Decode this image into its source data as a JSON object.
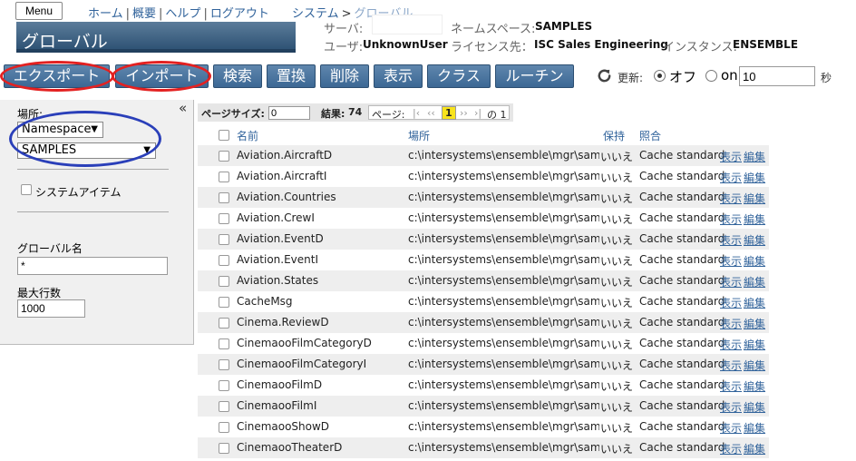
{
  "header": {
    "menu_label": "Menu",
    "nav": [
      "ホーム",
      "概要",
      "ヘルプ",
      "ログアウト"
    ],
    "nav_sep": "|",
    "breadcrumb": {
      "root": "システム",
      "sep": ">",
      "current": "グローバル"
    },
    "title": "グローバル",
    "server_label": "サーバ:",
    "server_value": "",
    "user_label": "ユーザ:",
    "user_value": "UnknownUser",
    "namespace_label": "ネームスペース:",
    "namespace_value": "SAMPLES",
    "license_label": "ライセンス先：",
    "license_value": "ISC Sales Engineering",
    "instance_label": "インスタンス:",
    "instance_value": "ENSEMBLE"
  },
  "toolbar": {
    "buttons": [
      "エクスポート",
      "インポート",
      "検索",
      "置換",
      "削除",
      "表示",
      "クラス",
      "ルーチン"
    ],
    "refresh_label": "更新:",
    "off_label": "オフ",
    "on_label": "on",
    "refresh_value": "10",
    "seconds_label": "秒",
    "refresh_mode": "off"
  },
  "sidebar": {
    "collapse_glyph": "«",
    "location_label": "場所:",
    "location_type": "Namespace",
    "location_value": "SAMPLES",
    "system_items_label": "システムアイテム",
    "global_name_label": "グローバル名",
    "global_name_value": "*",
    "max_rows_label": "最大行数",
    "max_rows_value": "1000"
  },
  "results": {
    "page_size_label": "ページサイズ:",
    "page_size_value": "0",
    "results_label": "結果:",
    "results_count": "74",
    "page_label": "ページ:",
    "nav_first": "|‹",
    "nav_prev": "‹‹",
    "current_page": "1",
    "nav_next": "››",
    "nav_last": "›|",
    "of_pages": "の 1"
  },
  "table": {
    "headers": {
      "name": "名前",
      "location": "場所",
      "keep": "保持",
      "collation": "照合"
    },
    "view_label": "表示",
    "edit_label": "編集",
    "rows": [
      {
        "name": "Aviation.AircraftD",
        "location": "c:\\intersystems\\ensemble\\mgr\\samples\\",
        "keep": "いいえ",
        "collation": "Cache standard"
      },
      {
        "name": "Aviation.AircraftI",
        "location": "c:\\intersystems\\ensemble\\mgr\\samples\\",
        "keep": "いいえ",
        "collation": "Cache standard"
      },
      {
        "name": "Aviation.Countries",
        "location": "c:\\intersystems\\ensemble\\mgr\\samples\\",
        "keep": "いいえ",
        "collation": "Cache standard"
      },
      {
        "name": "Aviation.CrewI",
        "location": "c:\\intersystems\\ensemble\\mgr\\samples\\",
        "keep": "いいえ",
        "collation": "Cache standard"
      },
      {
        "name": "Aviation.EventD",
        "location": "c:\\intersystems\\ensemble\\mgr\\samples\\",
        "keep": "いいえ",
        "collation": "Cache standard"
      },
      {
        "name": "Aviation.EventI",
        "location": "c:\\intersystems\\ensemble\\mgr\\samples\\",
        "keep": "いいえ",
        "collation": "Cache standard"
      },
      {
        "name": "Aviation.States",
        "location": "c:\\intersystems\\ensemble\\mgr\\samples\\",
        "keep": "いいえ",
        "collation": "Cache standard"
      },
      {
        "name": "CacheMsg",
        "location": "c:\\intersystems\\ensemble\\mgr\\samples\\",
        "keep": "いいえ",
        "collation": "Cache standard"
      },
      {
        "name": "Cinema.ReviewD",
        "location": "c:\\intersystems\\ensemble\\mgr\\samples\\",
        "keep": "いいえ",
        "collation": "Cache standard"
      },
      {
        "name": "CinemaooFilmCategoryD",
        "location": "c:\\intersystems\\ensemble\\mgr\\samples\\",
        "keep": "いいえ",
        "collation": "Cache standard"
      },
      {
        "name": "CinemaooFilmCategoryI",
        "location": "c:\\intersystems\\ensemble\\mgr\\samples\\",
        "keep": "いいえ",
        "collation": "Cache standard"
      },
      {
        "name": "CinemaooFilmD",
        "location": "c:\\intersystems\\ensemble\\mgr\\samples\\",
        "keep": "いいえ",
        "collation": "Cache standard"
      },
      {
        "name": "CinemaooFilmI",
        "location": "c:\\intersystems\\ensemble\\mgr\\samples\\",
        "keep": "いいえ",
        "collation": "Cache standard"
      },
      {
        "name": "CinemaooShowD",
        "location": "c:\\intersystems\\ensemble\\mgr\\samples\\",
        "keep": "いいえ",
        "collation": "Cache standard"
      },
      {
        "name": "CinemaooTheaterD",
        "location": "c:\\intersystems\\ensemble\\mgr\\samples\\",
        "keep": "いいえ",
        "collation": "Cache standard"
      }
    ]
  },
  "colors": {
    "button_blue": "#4a76a1",
    "title_bar": "#3e6384",
    "link_blue": "#31639b",
    "annotation_red": "#e32121",
    "annotation_blue": "#2a3fb9"
  }
}
